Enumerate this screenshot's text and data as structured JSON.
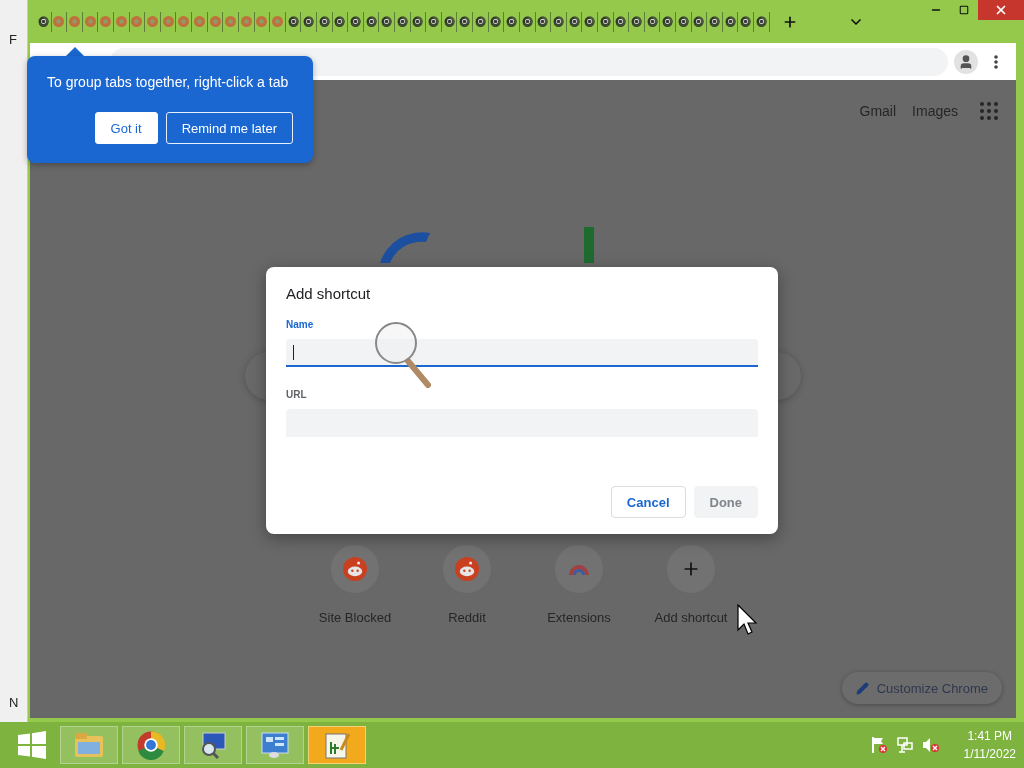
{
  "background_window": {
    "top_letter": "F",
    "bottom_letter": "N"
  },
  "tabs": [
    {
      "kind": "chrome"
    },
    {
      "kind": "reddit"
    },
    {
      "kind": "reddit"
    },
    {
      "kind": "reddit"
    },
    {
      "kind": "reddit"
    },
    {
      "kind": "reddit"
    },
    {
      "kind": "reddit"
    },
    {
      "kind": "reddit"
    },
    {
      "kind": "reddit"
    },
    {
      "kind": "reddit"
    },
    {
      "kind": "reddit"
    },
    {
      "kind": "reddit"
    },
    {
      "kind": "reddit"
    },
    {
      "kind": "reddit"
    },
    {
      "kind": "reddit"
    },
    {
      "kind": "reddit"
    },
    {
      "kind": "chrome"
    },
    {
      "kind": "chrome"
    },
    {
      "kind": "chrome"
    },
    {
      "kind": "chrome"
    },
    {
      "kind": "chrome"
    },
    {
      "kind": "chrome"
    },
    {
      "kind": "chrome"
    },
    {
      "kind": "chrome"
    },
    {
      "kind": "chrome"
    },
    {
      "kind": "chrome"
    },
    {
      "kind": "chrome"
    },
    {
      "kind": "chrome"
    },
    {
      "kind": "chrome"
    },
    {
      "kind": "chrome"
    },
    {
      "kind": "chrome"
    },
    {
      "kind": "chrome"
    },
    {
      "kind": "chrome"
    },
    {
      "kind": "chrome"
    },
    {
      "kind": "chrome"
    },
    {
      "kind": "chrome"
    },
    {
      "kind": "chrome"
    },
    {
      "kind": "chrome"
    },
    {
      "kind": "chrome"
    },
    {
      "kind": "chrome"
    },
    {
      "kind": "chrome"
    },
    {
      "kind": "chrome"
    },
    {
      "kind": "chrome"
    },
    {
      "kind": "chrome"
    },
    {
      "kind": "chrome"
    },
    {
      "kind": "chrome"
    },
    {
      "kind": "chrome"
    }
  ],
  "bubble": {
    "text": "To group tabs together, right-click a tab",
    "buttons": [
      {
        "label": "Got it",
        "kind": "primary"
      },
      {
        "label": "Remind me later",
        "kind": "outline"
      }
    ]
  },
  "header_links": [
    "Gmail",
    "Images"
  ],
  "dialog": {
    "title": "Add shortcut",
    "fields": [
      {
        "label": "Name",
        "focused": true
      },
      {
        "label": "URL",
        "focused": false
      }
    ],
    "buttons": [
      {
        "label": "Cancel",
        "disabled": false
      },
      {
        "label": "Done",
        "disabled": true
      }
    ]
  },
  "shortcuts": [
    {
      "label": "Site Blocked",
      "kind": "reddit"
    },
    {
      "label": "Reddit",
      "kind": "reddit"
    },
    {
      "label": "Extensions",
      "kind": "chrome"
    },
    {
      "label": "Add shortcut",
      "kind": "add"
    }
  ],
  "customize_button": "Customize Chrome",
  "taskbar": {
    "apps": [
      {
        "kind": "explorer",
        "selected": false
      },
      {
        "kind": "chrome",
        "selected": false
      },
      {
        "kind": "computer",
        "selected": false
      },
      {
        "kind": "control-panel",
        "selected": false
      },
      {
        "kind": "notepad",
        "selected": true
      }
    ],
    "clock": {
      "time": "1:41 PM",
      "date": "1/11/2022"
    }
  }
}
